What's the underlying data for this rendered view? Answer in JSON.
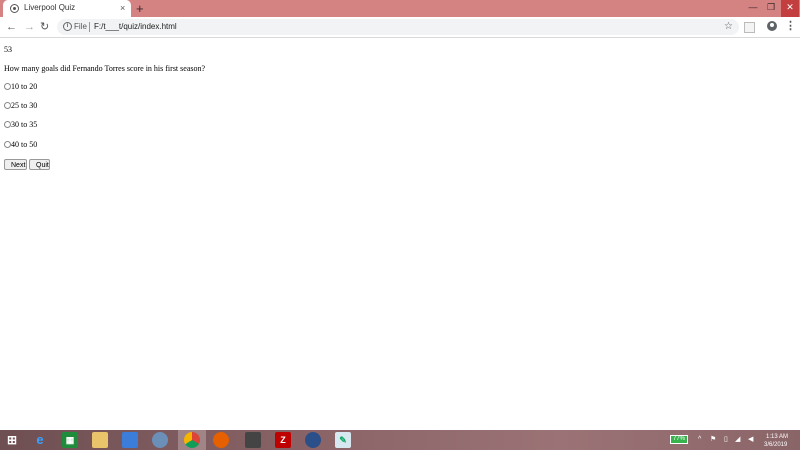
{
  "browser": {
    "tab_title": "Liverpool Quiz",
    "tab_close": "×",
    "new_tab": "+",
    "url_scheme_label": "File",
    "url": "F:/t___t/quiz/index.html",
    "window_controls": {
      "minimize": "—",
      "maximize": "❐",
      "close": "✕"
    },
    "nav": {
      "back": "←",
      "forward": "→",
      "reload": "↻"
    },
    "star": "☆",
    "menu": "⋮"
  },
  "quiz": {
    "score": "53",
    "question": "How many goals did Fernando Torres score in his first season?",
    "options": [
      "10 to 20",
      "25 to 30",
      "30 to 35",
      "40 to 50"
    ],
    "next_label": "Next",
    "quit_label": "Quit"
  },
  "taskbar": {
    "battery_percent": "77%",
    "time": "1:13 AM",
    "date": "3/6/2019",
    "apps": [
      "windows-start",
      "internet-explorer",
      "store",
      "file-explorer",
      "remote-desktop",
      "network",
      "chrome",
      "firefox",
      "app",
      "filezilla",
      "settings",
      "notepad"
    ]
  },
  "colors": {
    "titlebar": "#d58283",
    "close_button": "#c33e3e",
    "battery": "#37b24d"
  }
}
